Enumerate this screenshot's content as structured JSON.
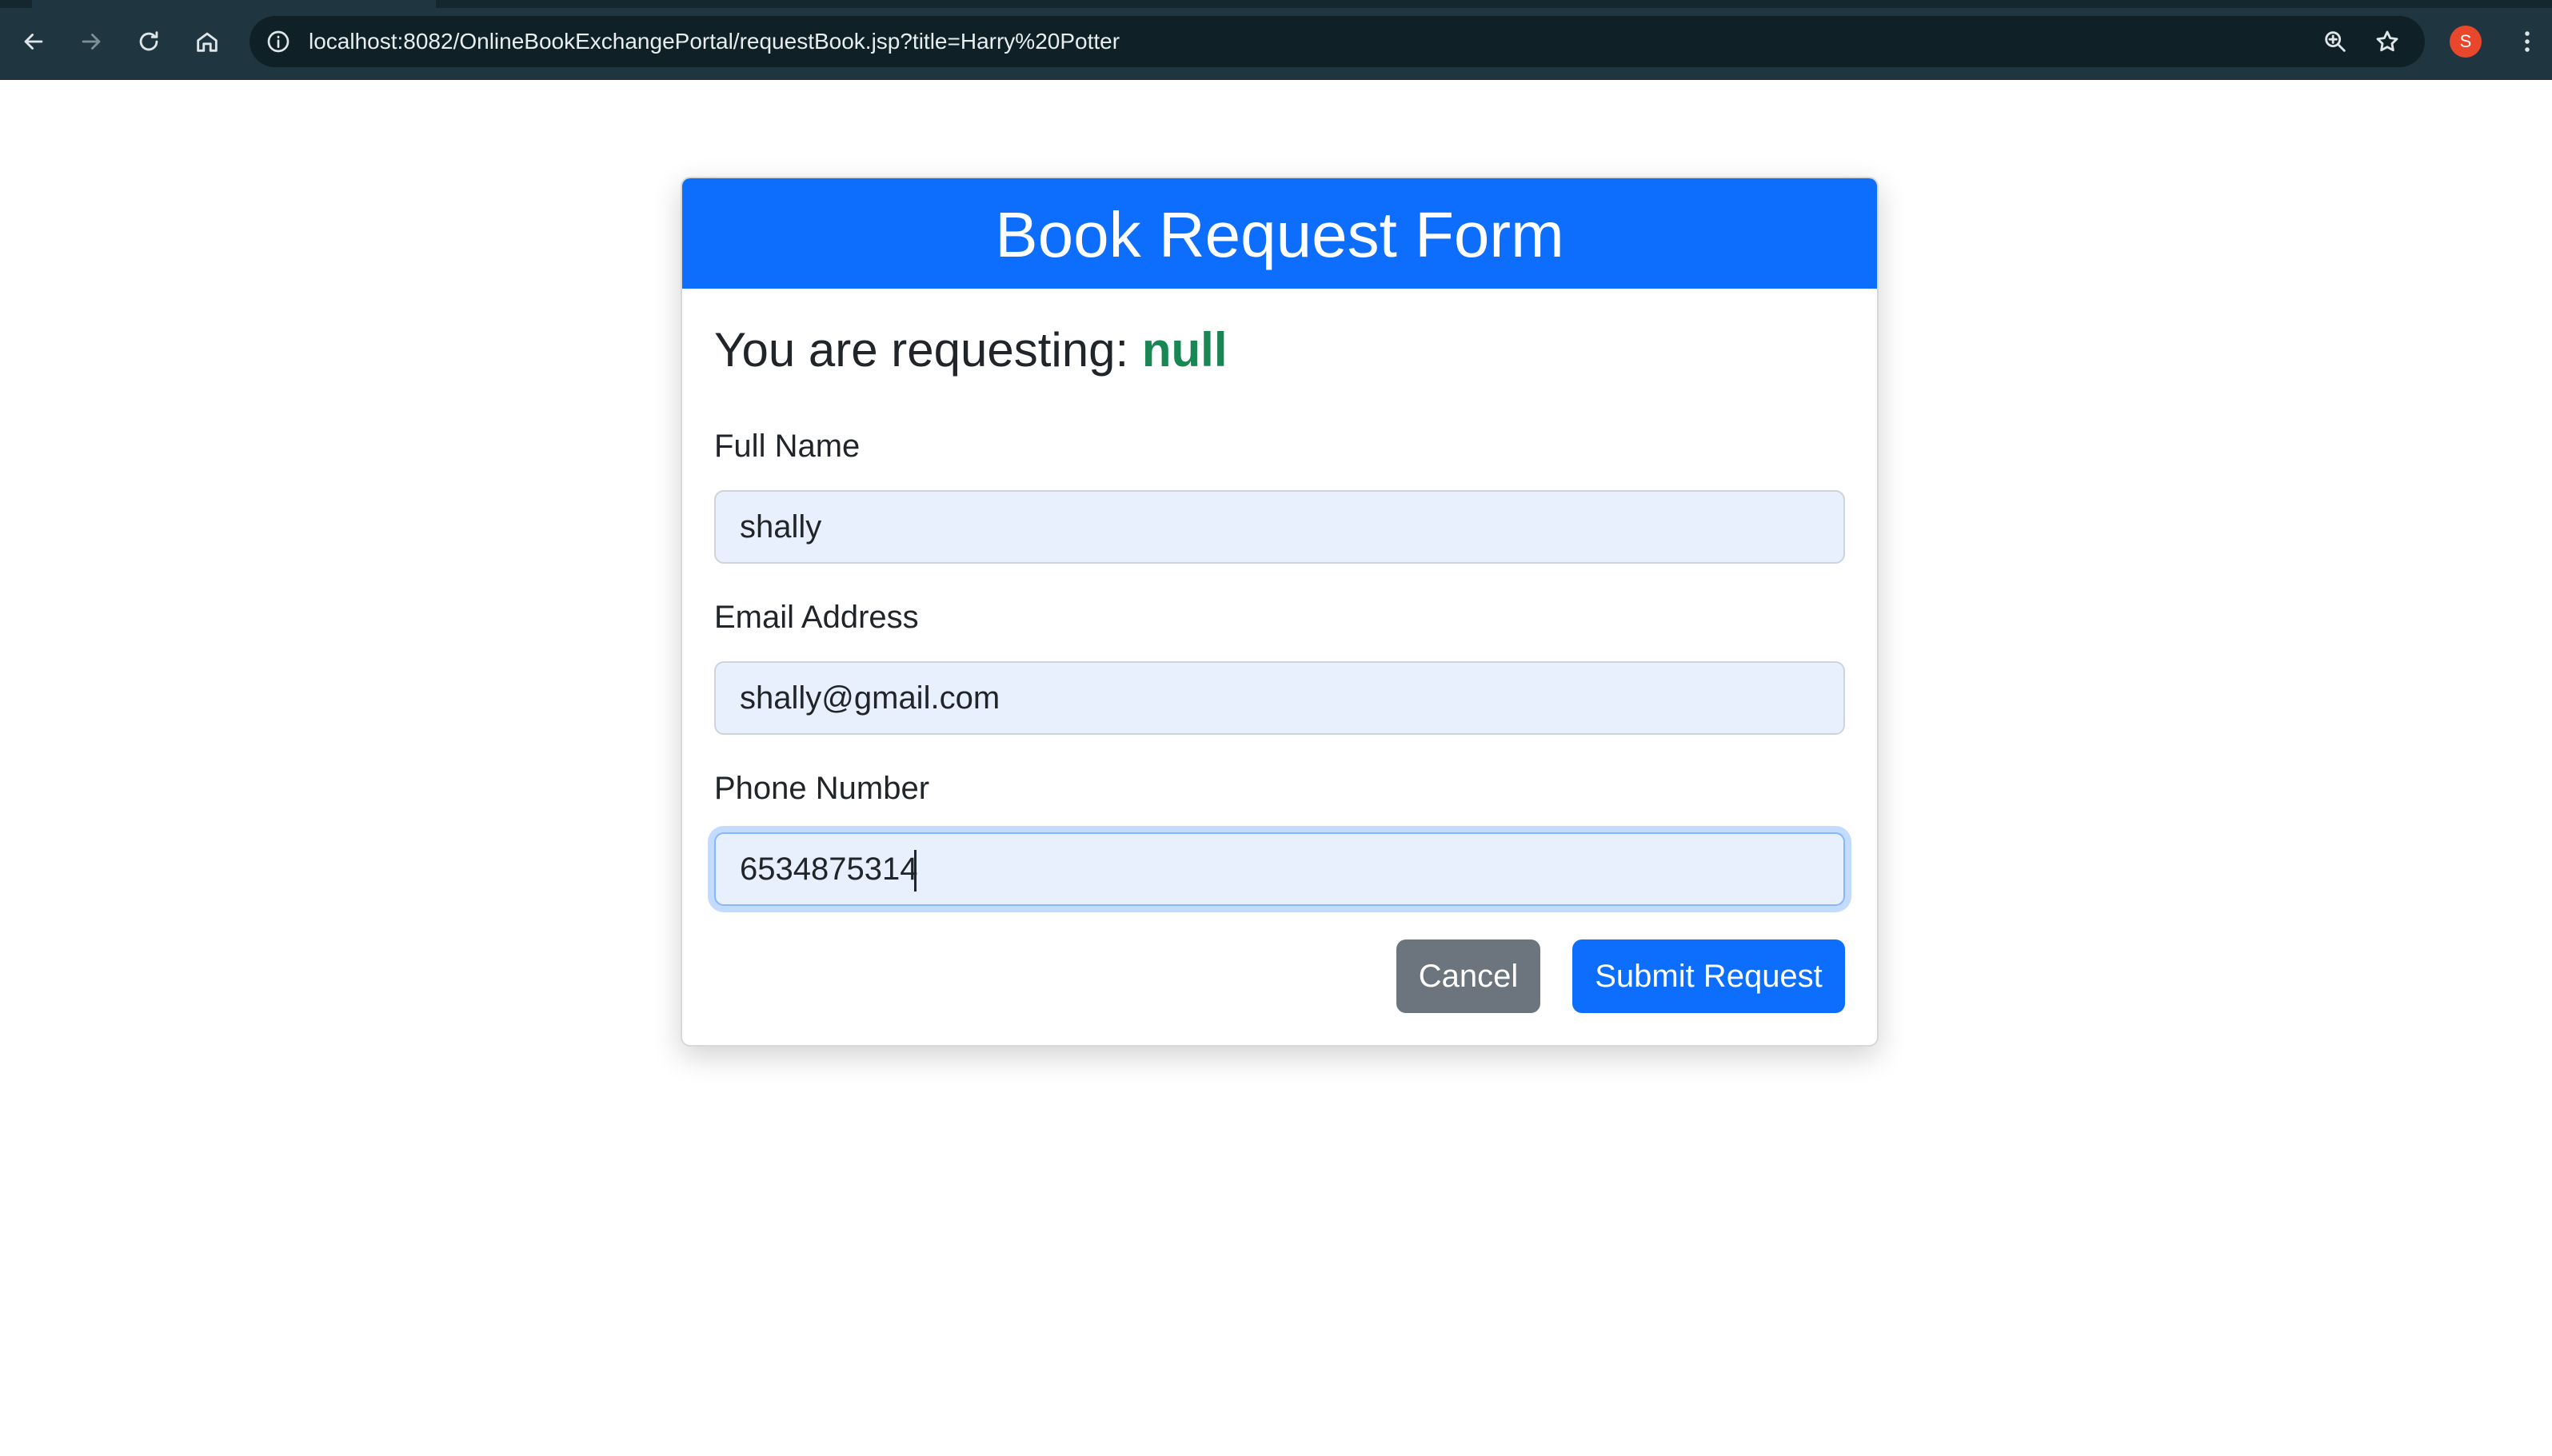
{
  "browser": {
    "url": "localhost:8082/OnlineBookExchangePortal/requestBook.jsp?title=Harry%20Potter",
    "profile_initial": "S",
    "icons": [
      "back-arrow-icon",
      "forward-arrow-icon",
      "reload-icon",
      "home-icon",
      "site-info-icon",
      "zoom-icon",
      "star-icon",
      "kebab-menu-icon"
    ]
  },
  "form": {
    "title": "Book Request Form",
    "requesting_prefix": "You are requesting:",
    "requesting_value": "null",
    "fields": {
      "full_name": {
        "label": "Full Name",
        "value": "shally"
      },
      "email": {
        "label": "Email Address",
        "value": "shally@gmail.com"
      },
      "phone": {
        "label": "Phone Number",
        "value": "6534875314"
      }
    },
    "buttons": {
      "cancel": "Cancel",
      "submit": "Submit Request"
    }
  },
  "colors": {
    "primary": "#0d6efd",
    "secondary": "#6c757d",
    "success": "#198754",
    "autofill_bg": "#e8f0fe",
    "chrome_bg": "#1f3640"
  }
}
